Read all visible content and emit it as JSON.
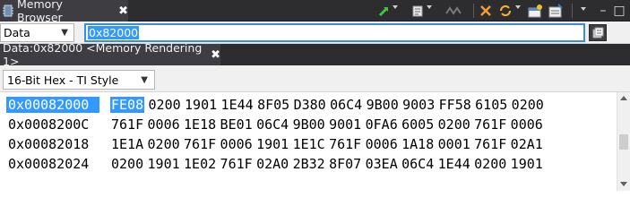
{
  "view": {
    "title": "Memory Browser",
    "close_glyph": "✖",
    "icon": "memory-chip-icon"
  },
  "toolbar": {
    "buttons": [
      {
        "name": "new-memory-monitor-icon",
        "has_dropdown": true
      },
      {
        "name": "refresh-icon",
        "has_dropdown": true
      },
      {
        "name": "toggle-watch-icon",
        "has_dropdown": false
      },
      {
        "name": "link-sync-icon",
        "has_dropdown": false
      },
      {
        "name": "refresh-continuous-icon",
        "has_dropdown": true
      },
      {
        "name": "new-rendering-icon",
        "has_dropdown": false
      },
      {
        "name": "clear-icon",
        "has_dropdown": false
      },
      {
        "name": "view-menu-icon",
        "has_dropdown": true
      }
    ],
    "min_glyph": "–",
    "max_glyph": "□"
  },
  "address_bar": {
    "space_value": "Data",
    "address_value": "0x82000",
    "dropdown_glyph": "▼"
  },
  "rendering_tab": {
    "label": "Data:0x82000 <Memory Rendering 1>",
    "close_glyph": "✖"
  },
  "format": {
    "value": "16-Bit Hex - TI Style",
    "dropdown_glyph": "▼"
  },
  "memory": {
    "rows": [
      {
        "address": "0x00082000",
        "words": [
          "FE08",
          "0200",
          "1901",
          "1E44",
          "8F05",
          "D380",
          "06C4",
          "9B00",
          "9003",
          "FF58",
          "6105",
          "0200"
        ]
      },
      {
        "address": "0x0008200C",
        "words": [
          "761F",
          "0006",
          "1E18",
          "BE01",
          "06C4",
          "9B00",
          "9001",
          "0FA6",
          "6005",
          "0200",
          "761F",
          "0006"
        ]
      },
      {
        "address": "0x00082018",
        "words": [
          "1E1A",
          "0200",
          "761F",
          "0006",
          "1901",
          "1E1C",
          "761F",
          "0006",
          "1A18",
          "0001",
          "761F",
          "02A1"
        ]
      },
      {
        "address": "0x00082024",
        "words": [
          "0200",
          "1901",
          "1E02",
          "761F",
          "02A0",
          "2B32",
          "8F07",
          "03EA",
          "06C4",
          "1E44",
          "0200",
          "1901"
        ]
      }
    ]
  },
  "colors": {
    "selection": "#3399ff",
    "tab_background": "#3e3e42",
    "tabbar_background": "#2d2d30"
  }
}
